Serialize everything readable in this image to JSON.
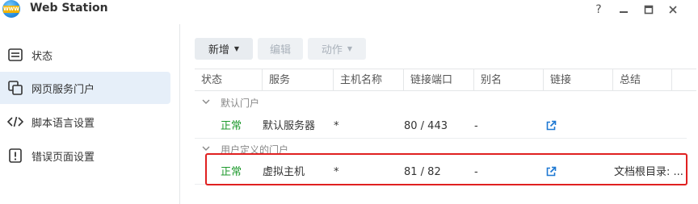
{
  "window": {
    "title": "Web Station",
    "icon_badge": "WWW",
    "help_label": "?",
    "minimize_label": "—",
    "close_label": "✕"
  },
  "sidebar": {
    "items": [
      {
        "label": "状态",
        "icon": "status-icon"
      },
      {
        "label": "网页服务门户",
        "icon": "portal-icon",
        "active": true
      },
      {
        "label": "脚本语言设置",
        "icon": "code-icon"
      },
      {
        "label": "错误页面设置",
        "icon": "error-icon"
      }
    ]
  },
  "toolbar": {
    "new_label": "新增",
    "edit_label": "编辑",
    "action_label": "动作"
  },
  "table": {
    "headers": [
      "状态",
      "服务",
      "主机名称",
      "链接端口",
      "别名",
      "链接",
      "总结"
    ],
    "groups": [
      {
        "label": "默认门户",
        "rows": [
          {
            "status": "正常",
            "service": "默认服务器",
            "host": "*",
            "port": "80 / 443",
            "alias": "-",
            "summary": ""
          }
        ]
      },
      {
        "label": "用户定义的门户",
        "rows": [
          {
            "status": "正常",
            "service": "虚拟主机",
            "host": "*",
            "port": "81 / 82",
            "alias": "-",
            "summary": "文档根目录: ..."
          }
        ]
      }
    ]
  },
  "colors": {
    "accent": "#1e78d2",
    "ok": "#1f9a2e",
    "highlight": "#e02020"
  }
}
